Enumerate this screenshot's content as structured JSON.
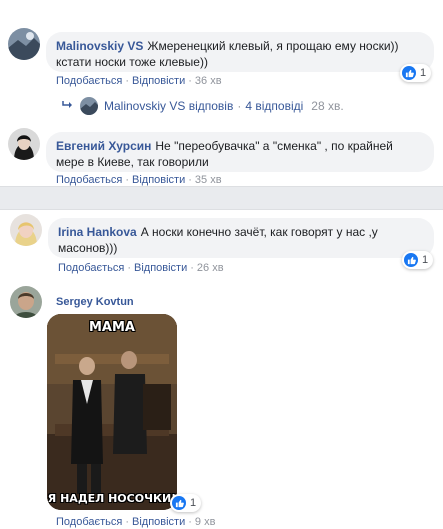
{
  "actions": {
    "like": "Подобається",
    "reply": "Відповісти",
    "separator": "·"
  },
  "comments": [
    {
      "author": "Malinovskiy VS",
      "text": "Жмеренецкий клевый, я прощаю ему носки)) кстати носки тоже клевые))",
      "time": "36 хв",
      "reaction_count": "1",
      "replies": {
        "author": "Malinovskiy VS",
        "label": "відповів",
        "count_text": "4 відповіді",
        "time": "28 хв."
      }
    },
    {
      "author": "Евгений Хурсин",
      "text": "Не \"переобувачка\" а \"сменка\" , по крайней мере в Киеве, так говорили",
      "time": "35 хв"
    },
    {
      "author": "Irina Hankova",
      "text": "А носки конечно зачёт, как говорят у нас ,у масонов)))",
      "time": "26 хв",
      "reaction_count": "1"
    },
    {
      "author": "Sergey Kovtun",
      "time": "9 хв",
      "reaction_count": "1",
      "meme": {
        "top_text": "МАМА",
        "bottom_text": "Я НАДЕЛ НОСОЧКИ!"
      }
    }
  ],
  "colors": {
    "link": "#385898",
    "bubble": "#f2f3f5",
    "like": "#1877f2",
    "band": "#e9ebee"
  }
}
